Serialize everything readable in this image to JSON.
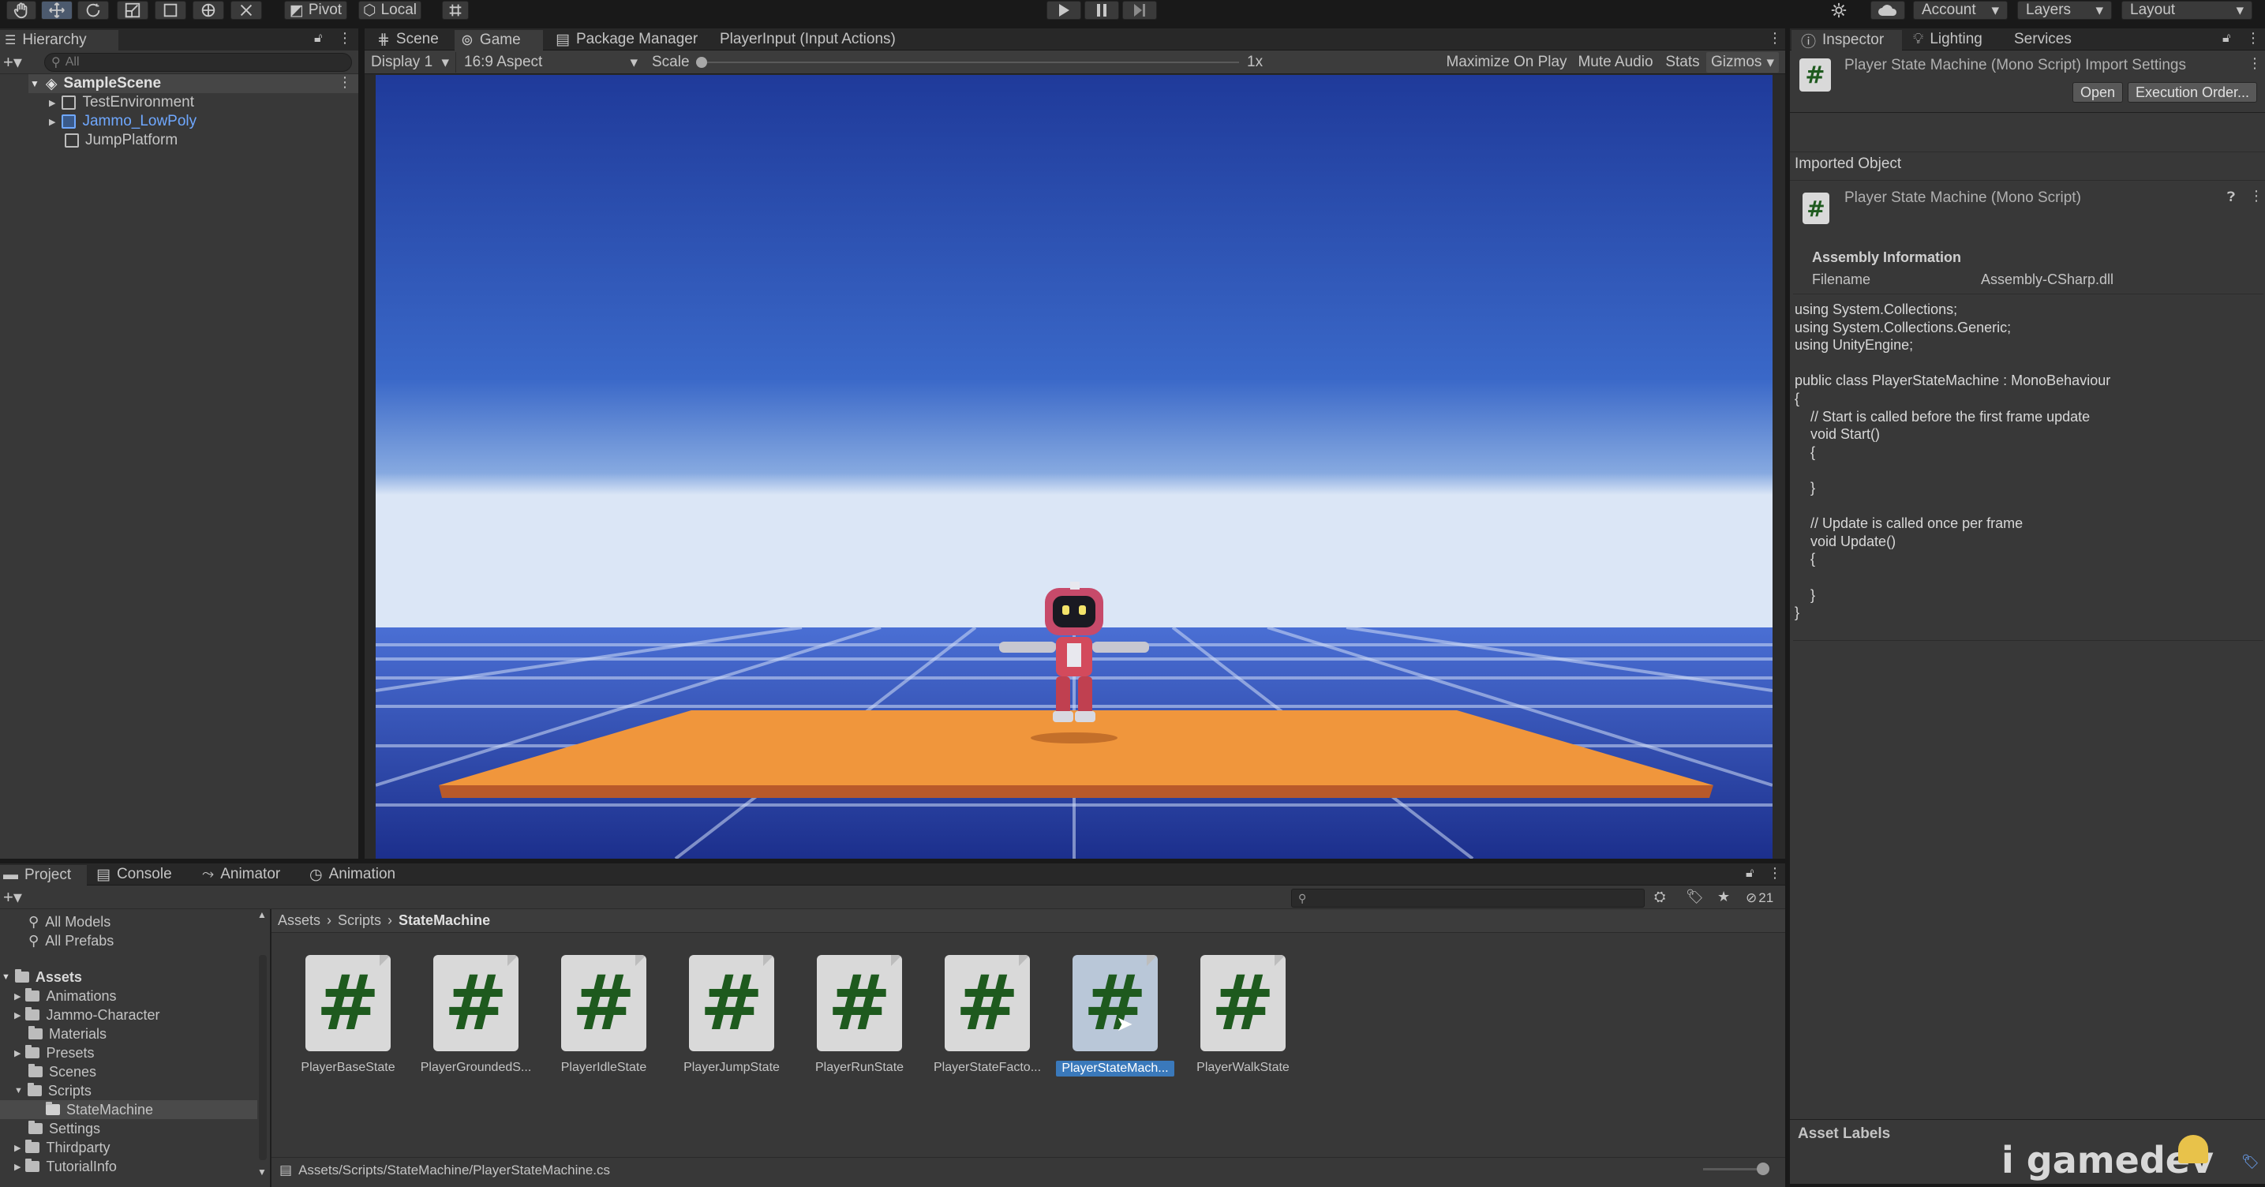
{
  "toolbar": {
    "pivot": "Pivot",
    "local": "Local",
    "account": "Account",
    "layers": "Layers",
    "layout": "Layout"
  },
  "hierarchy": {
    "title": "Hierarchy",
    "search_placeholder": "All",
    "items": [
      {
        "label": "SampleScene"
      },
      {
        "label": "TestEnvironment"
      },
      {
        "label": "Jammo_LowPoly"
      },
      {
        "label": "JumpPlatform"
      }
    ]
  },
  "center_tabs": [
    "Scene",
    "Game",
    "Package Manager",
    "PlayerInput (Input Actions)"
  ],
  "game_toolbar": {
    "display": "Display 1",
    "aspect": "16:9 Aspect",
    "scale_label": "Scale",
    "scale_value": "1x",
    "maximize": "Maximize On Play",
    "mute": "Mute Audio",
    "stats": "Stats",
    "gizmos": "Gizmos"
  },
  "inspector": {
    "tabs": [
      "Inspector",
      "Lighting",
      "Services"
    ],
    "header_title": "Player State Machine (Mono Script) Import Settings",
    "open_button": "Open",
    "execution_order_button": "Execution Order...",
    "imported_object": "Imported Object",
    "object_title": "Player State Machine (Mono Script)",
    "assembly_info": "Assembly Information",
    "filename_label": "Filename",
    "filename_value": "Assembly-CSharp.dll",
    "code": "using System.Collections;\nusing System.Collections.Generic;\nusing UnityEngine;\n\npublic class PlayerStateMachine : MonoBehaviour\n{\n    // Start is called before the first frame update\n    void Start()\n    {\n\n    }\n\n    // Update is called once per frame\n    void Update()\n    {\n\n    }\n}",
    "asset_labels": "Asset Labels"
  },
  "bottom_tabs": [
    "Project",
    "Console",
    "Animator",
    "Animation"
  ],
  "project": {
    "favorites": [
      "All Models",
      "All Prefabs"
    ],
    "assets_label": "Assets",
    "folders": [
      "Animations",
      "Jammo-Character",
      "Materials",
      "Presets",
      "Scenes",
      "Scripts",
      "StateMachine",
      "Settings",
      "Thirdparty",
      "TutorialInfo"
    ],
    "breadcrumb": [
      "Assets",
      "Scripts",
      "StateMachine"
    ],
    "hidden_count": "21",
    "assets": [
      "PlayerBaseState",
      "PlayerGroundedS...",
      "PlayerIdleState",
      "PlayerJumpState",
      "PlayerRunState",
      "PlayerStateFacto...",
      "PlayerStateMach...",
      "PlayerWalkState"
    ],
    "path": "Assets/Scripts/StateMachine/PlayerStateMachine.cs"
  },
  "watermark": "i gamedev",
  "colors": {
    "accent": "#3a79bb",
    "prefab_blue": "#6fa8ff",
    "script_green": "#1e5a1e",
    "platform_orange": "#f0963c"
  }
}
